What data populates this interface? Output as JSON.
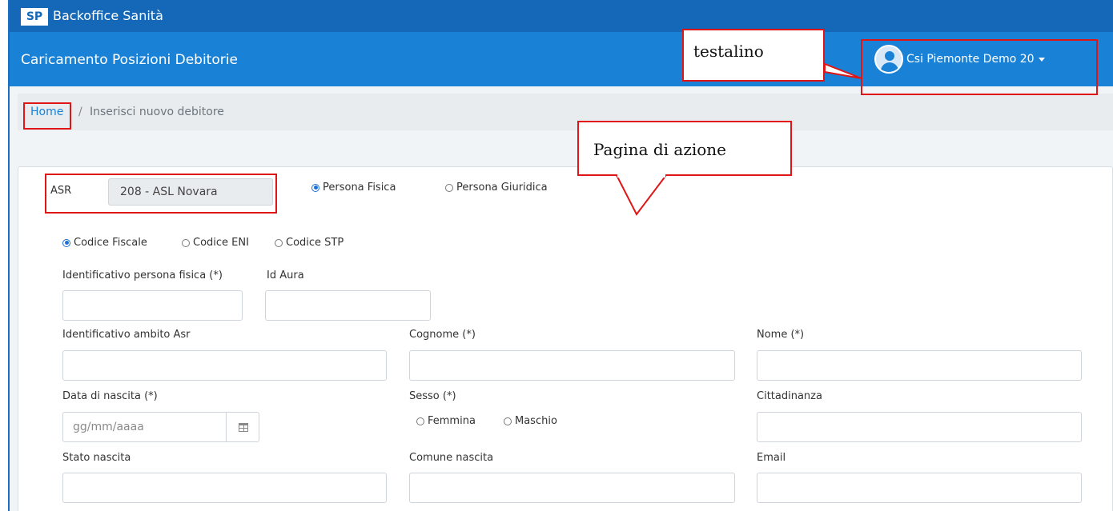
{
  "header": {
    "logo": "SP",
    "app_title": "Backoffice Sanità",
    "page_heading": "Caricamento Posizioni Debitorie",
    "user_name": "Csi Piemonte Demo 20"
  },
  "breadcrumb": {
    "home": "Home",
    "separator": "/",
    "current": "Inserisci nuovo debitore"
  },
  "form": {
    "asr_label": "ASR",
    "asr_value": "208 - ASL Novara",
    "subject_type": {
      "options": [
        "Persona Fisica",
        "Persona Giuridica"
      ],
      "selected": "Persona Fisica"
    },
    "id_type": {
      "options": [
        "Codice Fiscale",
        "Codice ENI",
        "Codice STP"
      ],
      "selected": "Codice Fiscale"
    },
    "labels": {
      "identificativo_pf": "Identificativo persona fisica (*)",
      "id_aura": "Id Aura",
      "identificativo_asr": "Identificativo ambito Asr",
      "cognome": "Cognome (*)",
      "nome": "Nome (*)",
      "data_nascita": "Data di nascita (*)",
      "sesso": "Sesso (*)",
      "cittadinanza": "Cittadinanza",
      "stato_nascita": "Stato nascita",
      "comune_nascita": "Comune nascita",
      "email": "Email"
    },
    "date_placeholder": "gg/mm/aaaa",
    "sex": {
      "options": [
        "Femmina",
        "Maschio"
      ],
      "selected": null
    }
  },
  "annotations": {
    "header_callout": "testalino",
    "action_callout": "Pagina di azione",
    "color": "#e01515"
  },
  "colors": {
    "top_bar": "#1567b7",
    "sub_bar": "#1a82d6",
    "breadcrumb_bg": "#e9ecef",
    "page_bg": "#f1f4f7"
  },
  "icons": {
    "avatar": "user-avatar-icon",
    "caret": "caret-down-icon",
    "calendar": "calendar-icon"
  }
}
